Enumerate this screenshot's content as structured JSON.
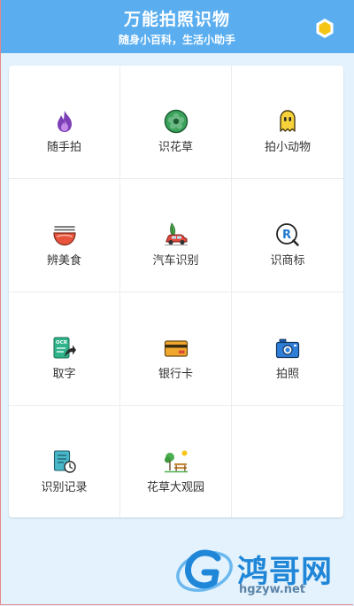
{
  "header": {
    "title": "万能拍照识物",
    "subtitle": "随身小百科，生活小助手",
    "settings_icon": "hexagon-icon"
  },
  "colors": {
    "header_bg": "#5aaef0",
    "page_bg": "#e3f2fc",
    "accent_yellow": "#f5c518"
  },
  "features": [
    {
      "label": "随手拍",
      "icon": "flame-icon"
    },
    {
      "label": "识花草",
      "icon": "flower-icon"
    },
    {
      "label": "拍小动物",
      "icon": "ghost-pet-icon"
    },
    {
      "label": "辨美食",
      "icon": "food-bowl-icon"
    },
    {
      "label": "汽车识别",
      "icon": "car-icon"
    },
    {
      "label": "识商标",
      "icon": "trademark-r-icon"
    },
    {
      "label": "取字",
      "icon": "ocr-icon"
    },
    {
      "label": "银行卡",
      "icon": "bank-card-icon"
    },
    {
      "label": "拍照",
      "icon": "camera-icon"
    },
    {
      "label": "识别记录",
      "icon": "record-clock-icon"
    },
    {
      "label": "花草大观园",
      "icon": "garden-icon"
    }
  ],
  "watermark": {
    "text": "鸿哥网",
    "url": "hgzyw.net"
  }
}
